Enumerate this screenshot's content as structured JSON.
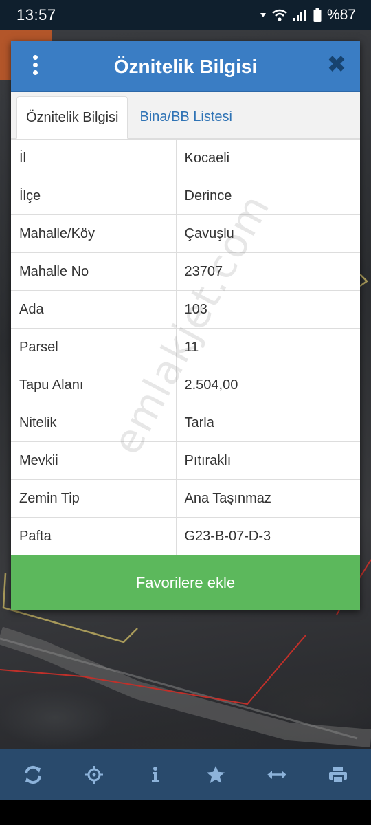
{
  "status_bar": {
    "time": "13:57",
    "battery": "%87"
  },
  "dialog": {
    "title": "Öznitelik Bilgisi",
    "tabs": [
      {
        "label": "Öznitelik Bilgisi",
        "active": true
      },
      {
        "label": "Bina/BB Listesi",
        "active": false
      }
    ],
    "rows": [
      {
        "key": "İl",
        "value": "Kocaeli"
      },
      {
        "key": "İlçe",
        "value": "Derince"
      },
      {
        "key": "Mahalle/Köy",
        "value": "Çavuşlu"
      },
      {
        "key": "Mahalle No",
        "value": "23707"
      },
      {
        "key": "Ada",
        "value": "103"
      },
      {
        "key": "Parsel",
        "value": "11"
      },
      {
        "key": "Tapu Alanı",
        "value": "2.504,00"
      },
      {
        "key": "Nitelik",
        "value": "Tarla"
      },
      {
        "key": "Mevkii",
        "value": "Pıtıraklı"
      },
      {
        "key": "Zemin Tip",
        "value": "Ana Taşınmaz"
      },
      {
        "key": "Pafta",
        "value": "G23-B-07-D-3"
      }
    ],
    "favorite_button": "Favorilere ekle"
  },
  "watermark": "emlakjet.com",
  "toolbar": {
    "icons": [
      "refresh-icon",
      "crosshair-icon",
      "info-icon",
      "star-icon",
      "measure-icon",
      "print-icon"
    ]
  },
  "colors": {
    "header": "#3a7dc4",
    "tab_link": "#2f73b5",
    "favorite": "#5cb85c",
    "toolbar": "#294a6c",
    "status_bar": "#0f1f2d"
  }
}
